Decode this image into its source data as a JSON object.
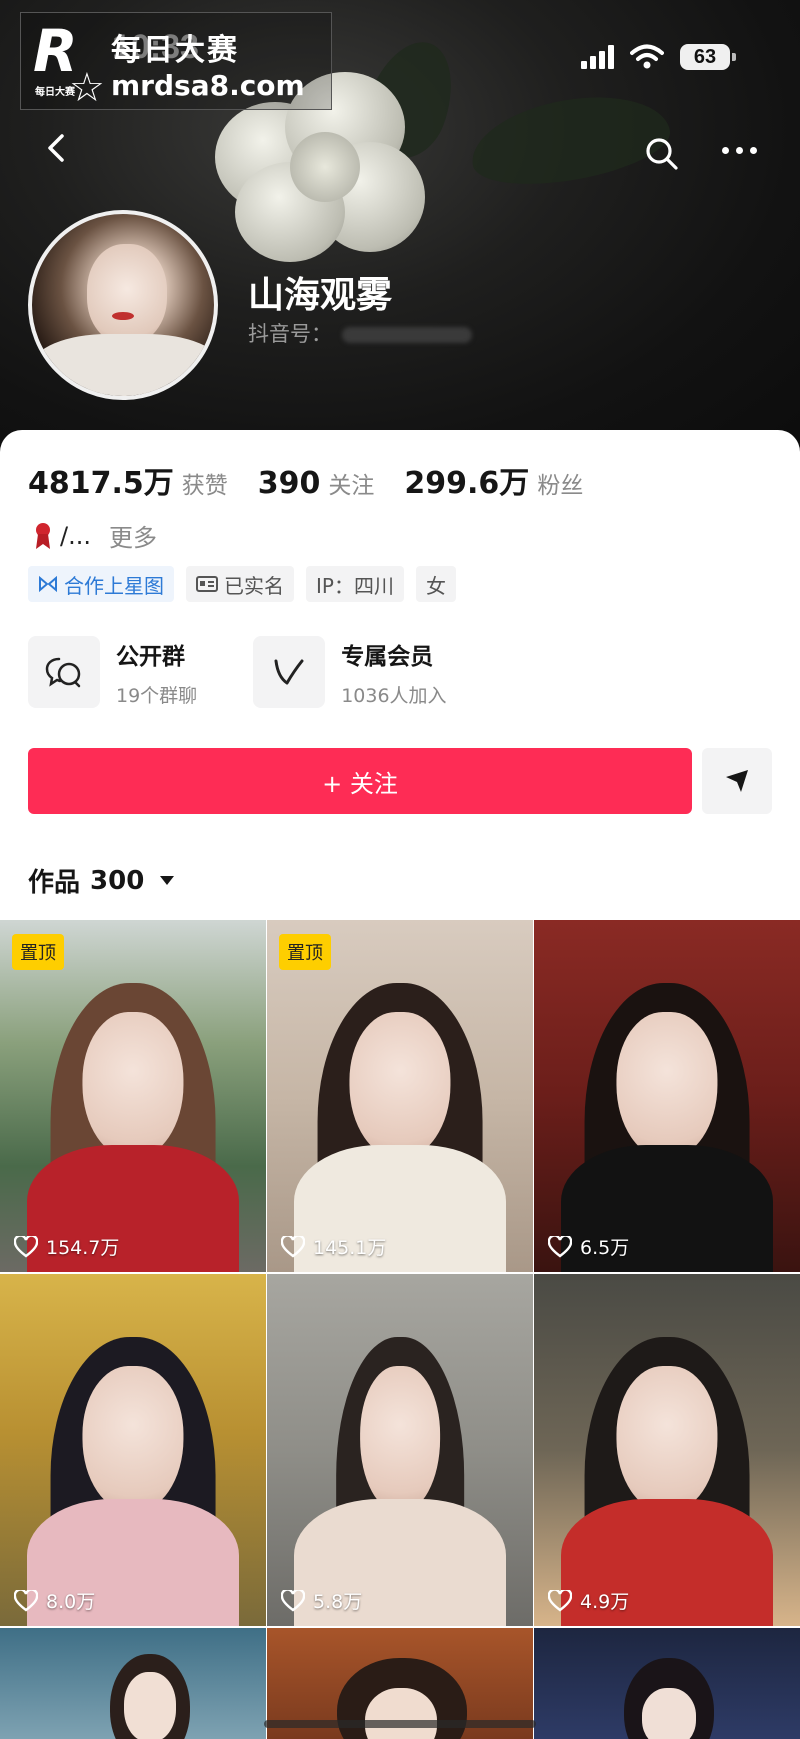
{
  "watermark": {
    "title": "每日大赛",
    "url": "mrdsa8.com",
    "logo_letter": "R",
    "logo_small": "每日大赛"
  },
  "status_bar": {
    "time": "10:33",
    "battery": "63"
  },
  "profile": {
    "name": "山海观雾",
    "douyin_id_label": "抖音号："
  },
  "stats": [
    {
      "value": "4817.5万",
      "label": "获赞"
    },
    {
      "value": "390",
      "label": "关注"
    },
    {
      "value": "299.6万",
      "label": "粉丝"
    }
  ],
  "bio": {
    "text": "/...",
    "more": "更多"
  },
  "tags": [
    {
      "label": "合作上星图",
      "icon": "star-graph-icon"
    },
    {
      "label": "已实名",
      "icon": "id-card-icon"
    },
    {
      "label": "IP：四川"
    },
    {
      "label": "女"
    }
  ],
  "groups": [
    {
      "title": "公开群",
      "subtitle": "19个群聊",
      "icon": "chat-bubbles-icon"
    },
    {
      "title": "专属会员",
      "subtitle": "1036人加入",
      "icon": "v-logo-icon"
    }
  ],
  "follow_button": "+ 关注",
  "works": {
    "label": "作品",
    "count": "300"
  },
  "posts": [
    {
      "pinned": "置顶",
      "likes": "154.7万"
    },
    {
      "pinned": "置顶",
      "likes": "145.1万"
    },
    {
      "pinned": "",
      "likes": "6.5万"
    },
    {
      "pinned": "",
      "likes": "8.0万"
    },
    {
      "pinned": "",
      "likes": "5.8万"
    },
    {
      "pinned": "",
      "likes": "4.9万"
    },
    {
      "pinned": "",
      "likes": ""
    },
    {
      "pinned": "",
      "likes": ""
    },
    {
      "pinned": "",
      "likes": ""
    }
  ]
}
